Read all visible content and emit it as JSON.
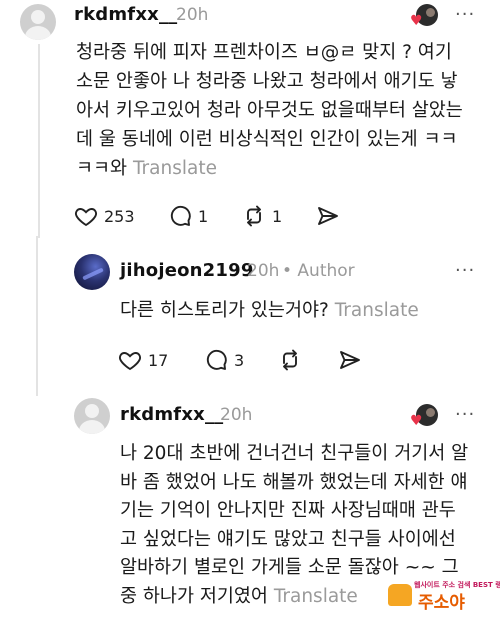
{
  "posts": [
    {
      "username": "rkdmfxx__",
      "time": "20h",
      "more": "···",
      "body_lines": [
        "청라중 뒤에 피자 프렌차이즈 ㅂ@ㄹ 맞지 ? 여기",
        "소문 안좋아 나 청라중 나왔고 청라에서 애기도 낳",
        "아서 키우고있어 청라 아무것도 없을때부터 살았는",
        "데 울 동네에 이런 비상식적인 인간이 있는게 ㅋㅋ",
        "ㅋㅋ와"
      ],
      "translate": "Translate",
      "likes": "253",
      "replies": "1",
      "reposts": "1"
    },
    {
      "username": "jihojeon2199",
      "time": "20h",
      "badge": "• Author",
      "more": "···",
      "body_lines": [
        "다른 히스토리가 있는거야?"
      ],
      "translate": "Translate",
      "likes": "17",
      "replies": "3"
    },
    {
      "username": "rkdmfxx__",
      "time": "20h",
      "more": "···",
      "body_lines": [
        "나 20대 초반에 건너건너 친구들이 거기서 알",
        "바 좀 했었어 나도 해볼까 했었는데 자세한 얘",
        "기는 기억이 안나지만 진짜 사장님때매 관두",
        "고 싶었다는 얘기도 많았고 친구들 사이에선",
        "알바하기 별로인 가게들 소문 돌잖아 ~~ 그",
        "중 하나가 저기였어"
      ],
      "translate": "Translate"
    }
  ],
  "watermark": {
    "small": "웹사이트 주소 검색 BEST 랭킹",
    "big": "주소야"
  },
  "icons": [
    "heart-icon",
    "comment-icon",
    "repost-icon",
    "share-icon"
  ]
}
